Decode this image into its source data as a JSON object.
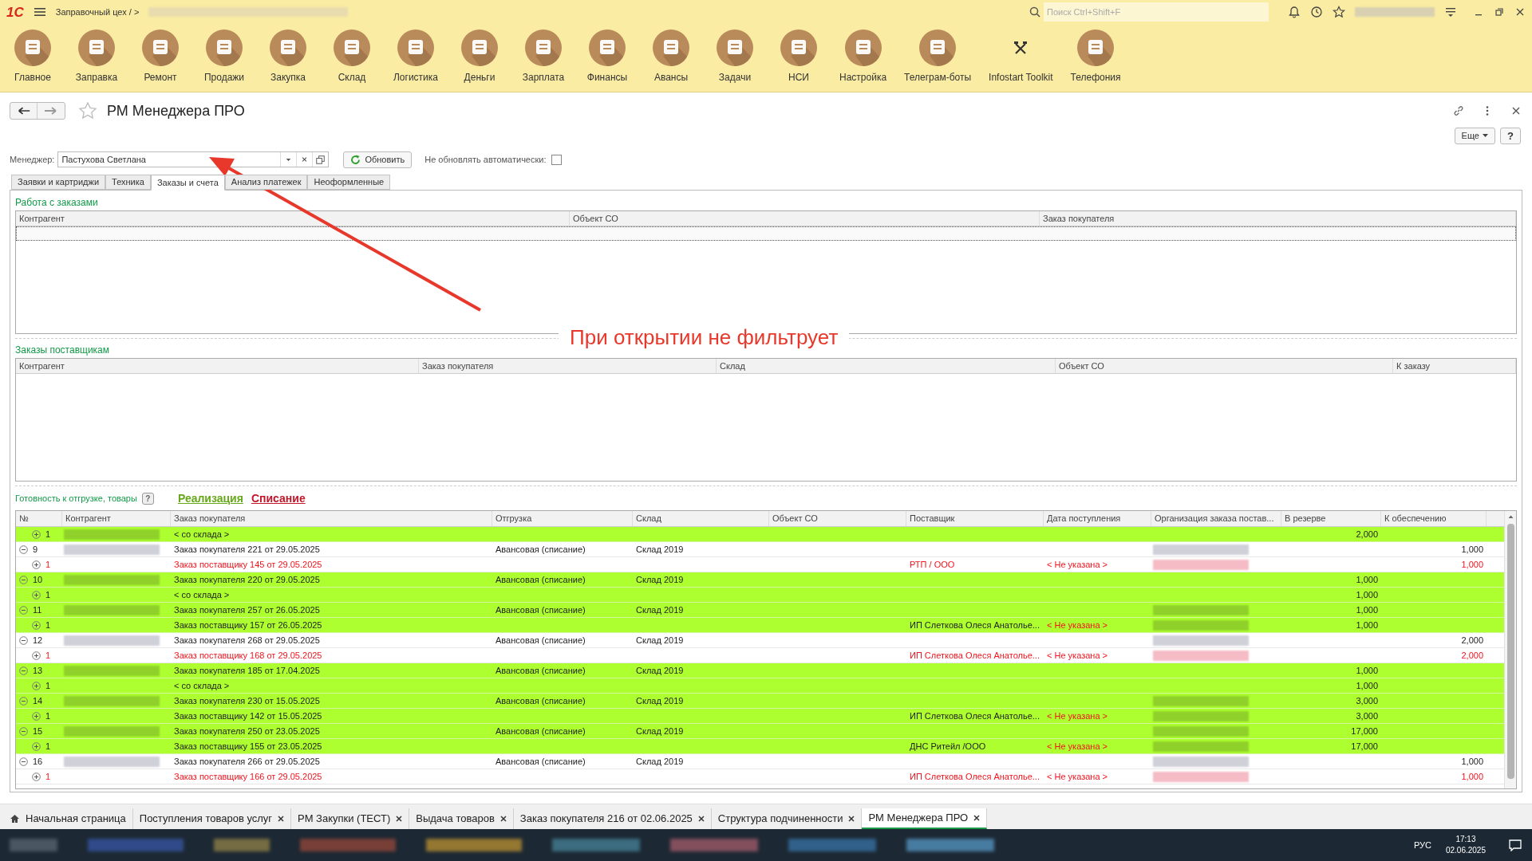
{
  "top_bar": {
    "logo": "1С",
    "breadcrumb": "Заправочный цех / >",
    "search": {
      "placeholder": "Поиск Ctrl+Shift+F"
    }
  },
  "sections": [
    {
      "label": "Главное",
      "kind": "round"
    },
    {
      "label": "Заправка",
      "kind": "round"
    },
    {
      "label": "Ремонт",
      "kind": "round"
    },
    {
      "label": "Продажи",
      "kind": "round"
    },
    {
      "label": "Закупка",
      "kind": "round"
    },
    {
      "label": "Склад",
      "kind": "round"
    },
    {
      "label": "Логистика",
      "kind": "round"
    },
    {
      "label": "Деньги",
      "kind": "round"
    },
    {
      "label": "Зарплата",
      "kind": "round"
    },
    {
      "label": "Финансы",
      "kind": "round"
    },
    {
      "label": "Авансы",
      "kind": "round"
    },
    {
      "label": "Задачи",
      "kind": "round"
    },
    {
      "label": "НСИ",
      "kind": "round"
    },
    {
      "label": "Настройка",
      "kind": "round"
    },
    {
      "label": "Телеграм-боты",
      "kind": "round"
    },
    {
      "label": "Infostart Toolkit",
      "kind": "plain"
    },
    {
      "label": "Телефония",
      "kind": "round"
    }
  ],
  "form": {
    "title": "РМ Менеджера ПРО",
    "more_button": "Еще",
    "help_button": "?",
    "manager_label": "Менеджер:",
    "manager_value": "Пастухова Светлана",
    "refresh_button": "Обновить",
    "auto_label": "Не обновлять автоматически:",
    "auto_checked": false
  },
  "form_tabs": [
    {
      "label": "Заявки и картриджи",
      "selected": false
    },
    {
      "label": "Техника",
      "selected": false
    },
    {
      "label": "Заказы и счета",
      "selected": true
    },
    {
      "label": "Анализ платежек",
      "selected": false
    },
    {
      "label": "Неоформленные",
      "selected": false
    }
  ],
  "orders_work": {
    "title": "Работа с заказами",
    "columns": [
      "Контрагент",
      "Объект СО",
      "Заказ покупателя"
    ]
  },
  "supplier_orders": {
    "title": "Заказы поставщикам",
    "columns": [
      "Контрагент",
      "Заказ покупателя",
      "Склад",
      "Объект СО",
      "К заказу"
    ]
  },
  "readiness": {
    "title": "Готовность к отгрузке, товары",
    "link_sale": "Реализация",
    "link_writeoff": "Списание",
    "columns": [
      "№",
      "Контрагент",
      "Заказ покупателя",
      "Отгрузка",
      "Склад",
      "Объект СО",
      "Поставщик",
      "Дата поступления",
      "Организация заказа постав...",
      "В резерве",
      "К обеспечению"
    ],
    "rows": [
      {
        "children": [
          {
            "number": "1",
            "expanded": false,
            "highlighted": true,
            "alert": false,
            "contractor_blurred": true,
            "order": "< со склада >",
            "reserve": "2,000"
          }
        ]
      },
      {
        "number": "9",
        "expanded": true,
        "highlighted": false,
        "contractor_blurred": true,
        "order": "Заказ покупателя 221 от 29.05.2025",
        "shipment": "Авансовая (списание)",
        "warehouse": "Склад 2019",
        "org_blurred": true,
        "to_supply": "1,000",
        "children": [
          {
            "number": "1",
            "expanded": false,
            "highlighted": false,
            "alert": true,
            "order": "Заказ поставщику 145 от 29.05.2025",
            "supplier": "РТП / ООО",
            "date": "< Не указана >",
            "org_blurred": true,
            "to_supply": "1,000"
          }
        ]
      },
      {
        "number": "10",
        "expanded": true,
        "highlighted": true,
        "contractor_blurred": true,
        "order": "Заказ покупателя 220 от 29.05.2025",
        "shipment": "Авансовая (списание)",
        "warehouse": "Склад 2019",
        "reserve": "1,000",
        "children": [
          {
            "number": "1",
            "expanded": false,
            "highlighted": true,
            "alert": false,
            "order": "< со склада >",
            "reserve": "1,000"
          }
        ]
      },
      {
        "number": "11",
        "expanded": true,
        "highlighted": true,
        "contractor_blurred": true,
        "order": "Заказ покупателя 257 от 26.05.2025",
        "shipment": "Авансовая (списание)",
        "warehouse": "Склад 2019",
        "org_blurred": true,
        "reserve": "1,000",
        "children": [
          {
            "number": "1",
            "expanded": false,
            "highlighted": true,
            "alert": false,
            "order": "Заказ поставщику 157 от 26.05.2025",
            "supplier": "ИП Слеткова Олеся Анатолье...",
            "date": "< Не указана >",
            "org_blurred": true,
            "reserve": "1,000"
          }
        ]
      },
      {
        "number": "12",
        "expanded": true,
        "highlighted": false,
        "contractor_blurred": true,
        "order": "Заказ покупателя 268 от 29.05.2025",
        "shipment": "Авансовая (списание)",
        "warehouse": "Склад 2019",
        "org_blurred": true,
        "to_supply": "2,000",
        "children": [
          {
            "number": "1",
            "expanded": false,
            "highlighted": false,
            "alert": true,
            "order": "Заказ поставщику 168 от 29.05.2025",
            "supplier": "ИП Слеткова Олеся Анатолье...",
            "date": "< Не указана >",
            "org_blurred": true,
            "to_supply": "2,000"
          }
        ]
      },
      {
        "number": "13",
        "expanded": true,
        "highlighted": true,
        "contractor_blurred": true,
        "order": "Заказ покупателя 185 от 17.04.2025",
        "shipment": "Авансовая (списание)",
        "warehouse": "Склад 2019",
        "reserve": "1,000",
        "children": [
          {
            "number": "1",
            "expanded": false,
            "highlighted": true,
            "alert": false,
            "order": "< со склада >",
            "reserve": "1,000"
          }
        ]
      },
      {
        "number": "14",
        "expanded": true,
        "highlighted": true,
        "contractor_blurred": true,
        "order": "Заказ покупателя 230 от 15.05.2025",
        "shipment": "Авансовая (списание)",
        "warehouse": "Склад 2019",
        "org_blurred": true,
        "reserve": "3,000",
        "children": [
          {
            "number": "1",
            "expanded": false,
            "highlighted": true,
            "alert": false,
            "order": "Заказ поставщику 142 от 15.05.2025",
            "supplier": "ИП Слеткова Олеся Анатолье...",
            "date": "< Не указана >",
            "org_blurred": true,
            "reserve": "3,000"
          }
        ]
      },
      {
        "number": "15",
        "expanded": true,
        "highlighted": true,
        "contractor_blurred": true,
        "order": "Заказ покупателя 250 от 23.05.2025",
        "shipment": "Авансовая (списание)",
        "warehouse": "Склад 2019",
        "org_blurred": true,
        "reserve": "17,000",
        "children": [
          {
            "number": "1",
            "expanded": false,
            "highlighted": true,
            "alert": false,
            "order": "Заказ поставщику 155 от 23.05.2025",
            "supplier": "ДНС Ритейл /ООО",
            "date": "< Не указана >",
            "org_blurred": true,
            "reserve": "17,000"
          }
        ]
      },
      {
        "number": "16",
        "expanded": true,
        "highlighted": false,
        "contractor_blurred": true,
        "order": "Заказ покупателя 266 от 29.05.2025",
        "shipment": "Авансовая (списание)",
        "warehouse": "Склад 2019",
        "org_blurred": true,
        "to_supply": "1,000",
        "children": [
          {
            "number": "1",
            "expanded": false,
            "highlighted": false,
            "alert": true,
            "order": "Заказ поставщику 166 от 29.05.2025",
            "supplier": "ИП Слеткова Олеся Анатолье...",
            "date": "< Не указана >",
            "org_blurred": true,
            "to_supply": "1,000"
          }
        ]
      }
    ]
  },
  "annotation": {
    "text": "При открытии не фильтрует"
  },
  "open_tabs": [
    {
      "label": "Начальная страница",
      "kind": "home",
      "selected": false
    },
    {
      "label": "Поступления товаров услуг",
      "kind": "closable",
      "selected": false
    },
    {
      "label": "РМ Закупки (ТЕСТ)",
      "kind": "closable",
      "selected": false
    },
    {
      "label": "Выдача товаров",
      "kind": "closable",
      "selected": false
    },
    {
      "label": "Заказ покупателя 216 от 02.06.2025",
      "kind": "closable",
      "selected": false
    },
    {
      "label": "Структура подчиненности",
      "kind": "closable",
      "selected": false
    },
    {
      "label": "РМ Менеджера ПРО",
      "kind": "closable",
      "selected": true
    }
  ],
  "taskbar": {
    "language": "РУС",
    "time": "17:13",
    "date": "02.06.2025"
  }
}
